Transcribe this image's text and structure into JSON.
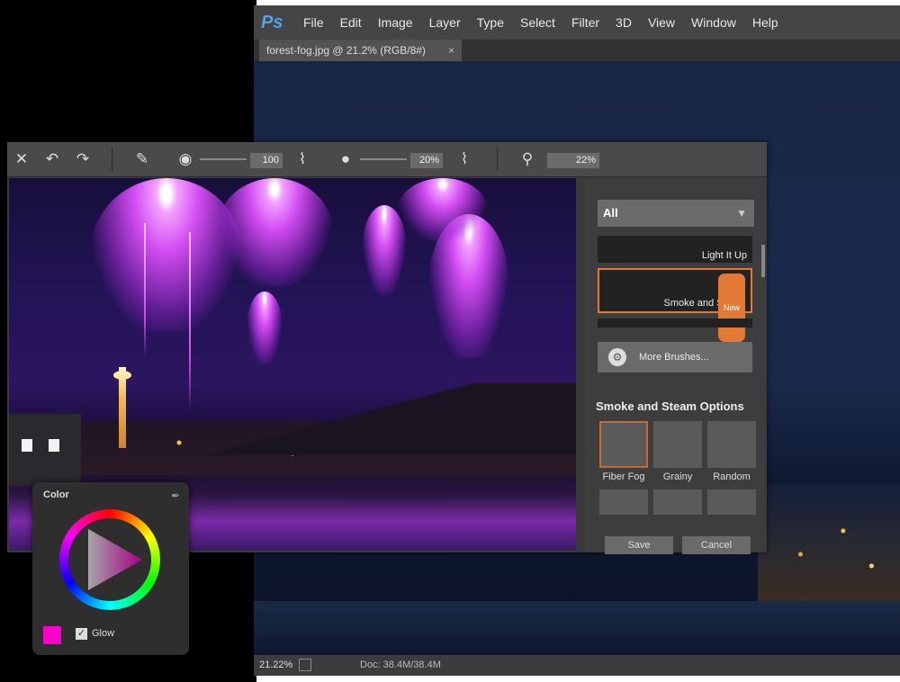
{
  "ps": {
    "logo": "Ps",
    "menu": [
      "File",
      "Edit",
      "Image",
      "Layer",
      "Type",
      "Select",
      "Filter",
      "3D",
      "View",
      "Window",
      "Help"
    ],
    "tab_title": "forest-fog.jpg @ 21.2% (RGB/8#)",
    "tab_close": "×",
    "status_zoom": "21.22%",
    "status_doc": "Doc: 38.4M/38.4M"
  },
  "toolbar": {
    "size_value": "100",
    "opacity_value": "20%",
    "zoom_value": "22%"
  },
  "panel": {
    "category": "All",
    "brushes": [
      {
        "label": "Light It Up"
      },
      {
        "label": "Smoke and Steam",
        "badge": "New"
      }
    ],
    "more_brushes": "More Brushes...",
    "options_title": "Smoke and Steam Options",
    "options": [
      "Fiber Fog",
      "Grainy",
      "Random"
    ],
    "save": "Save",
    "cancel": "Cancel"
  },
  "color": {
    "title": "Color",
    "swatch_color": "#ff00cc",
    "glow_label": "Glow",
    "glow_checked": true
  }
}
